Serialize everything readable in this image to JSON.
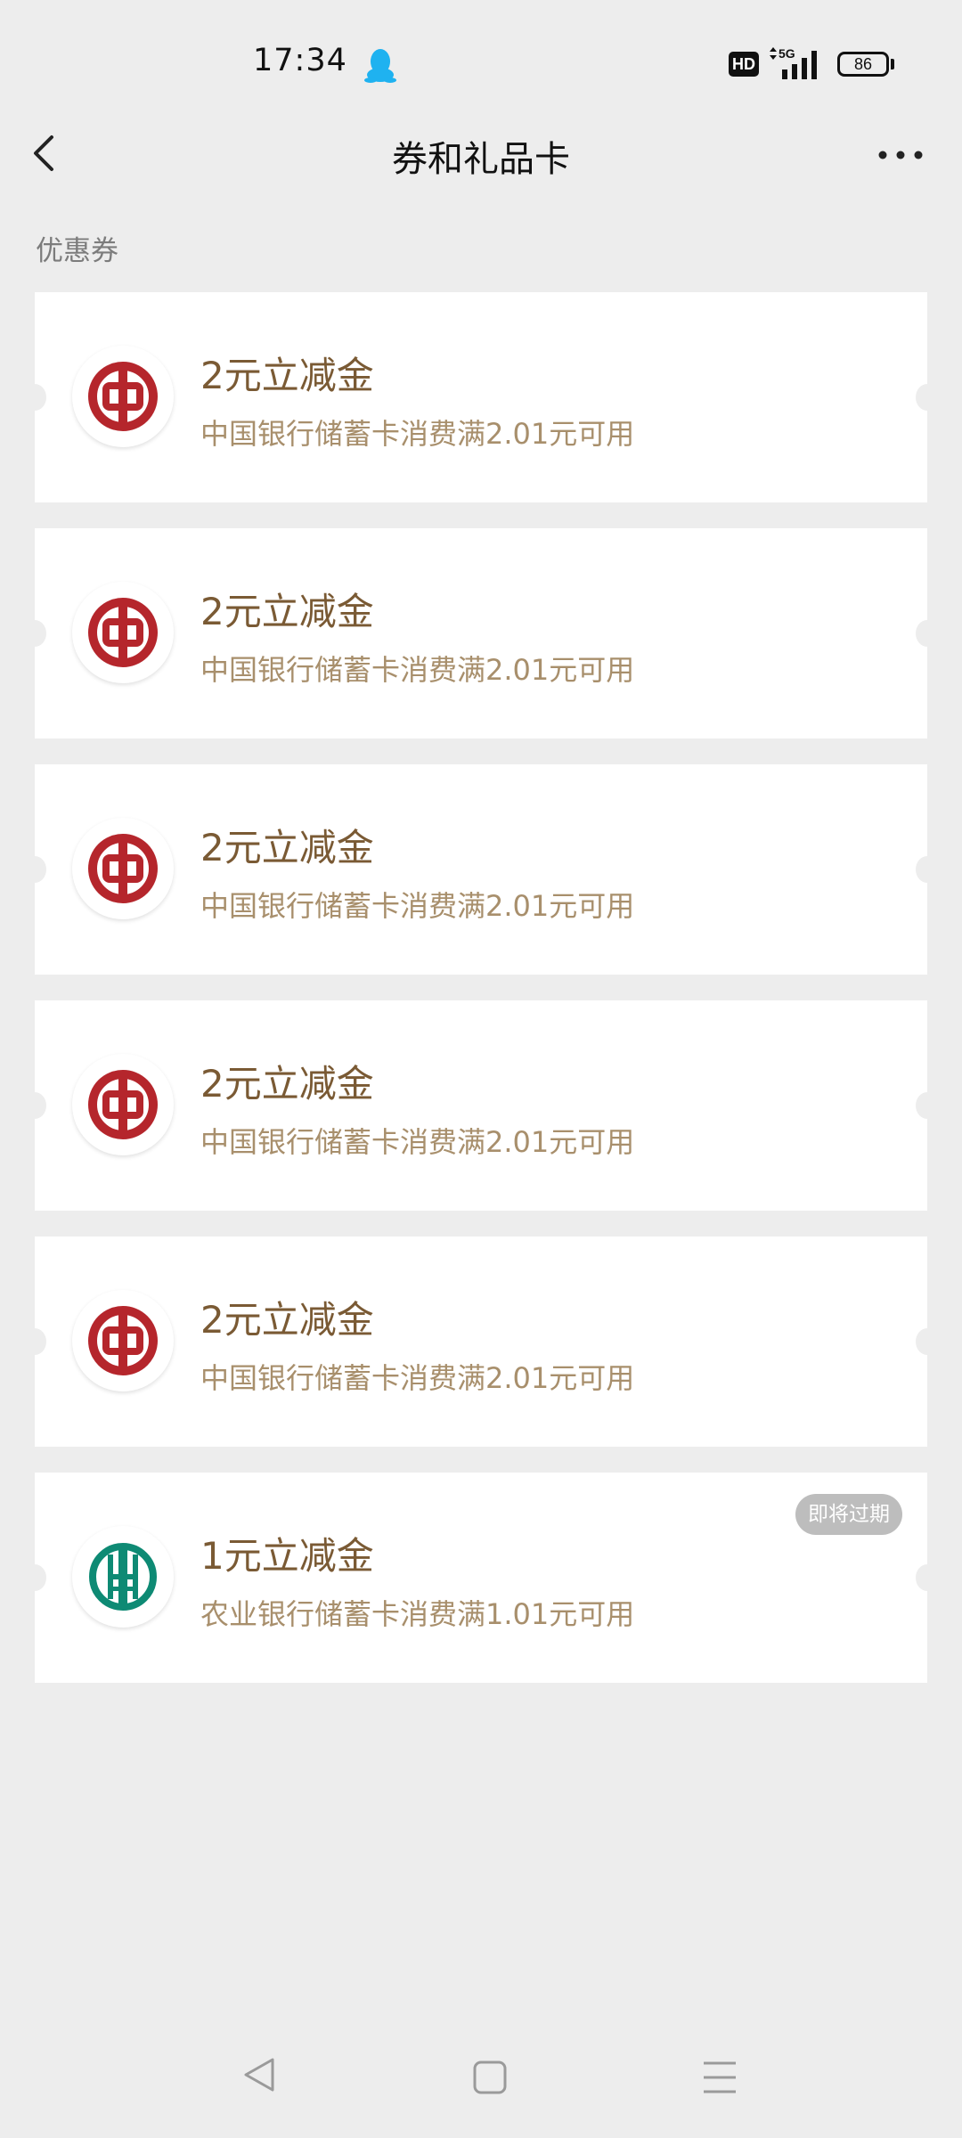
{
  "status_bar": {
    "time": "17:34",
    "hd": "HD",
    "network": "5G",
    "battery": "86"
  },
  "header": {
    "title": "券和礼品卡"
  },
  "section": {
    "title": "优惠券"
  },
  "coupons": [
    {
      "bank": "boc",
      "title": "2元立减金",
      "desc": "中国银行储蓄卡消费满2.01元可用"
    },
    {
      "bank": "boc",
      "title": "2元立减金",
      "desc": "中国银行储蓄卡消费满2.01元可用"
    },
    {
      "bank": "boc",
      "title": "2元立减金",
      "desc": "中国银行储蓄卡消费满2.01元可用"
    },
    {
      "bank": "boc",
      "title": "2元立减金",
      "desc": "中国银行储蓄卡消费满2.01元可用"
    },
    {
      "bank": "boc",
      "title": "2元立减金",
      "desc": "中国银行储蓄卡消费满2.01元可用"
    },
    {
      "bank": "abc",
      "title": "1元立减金",
      "desc": "农业银行储蓄卡消费满1.01元可用",
      "badge": "即将过期"
    }
  ],
  "colors": {
    "boc_red": "#b5262c",
    "abc_green": "#0e8a74",
    "coupon_title": "#7a5a34",
    "coupon_desc": "#a88f6c",
    "background": "#ededed"
  },
  "icons": {
    "back": "back-chevron-icon",
    "more": "more-dots-icon",
    "qq": "qq-penguin-icon",
    "signal": "signal-bars-icon",
    "sys_back": "triangle-back-icon",
    "sys_home": "square-home-icon",
    "sys_menu": "menu-lines-icon"
  }
}
